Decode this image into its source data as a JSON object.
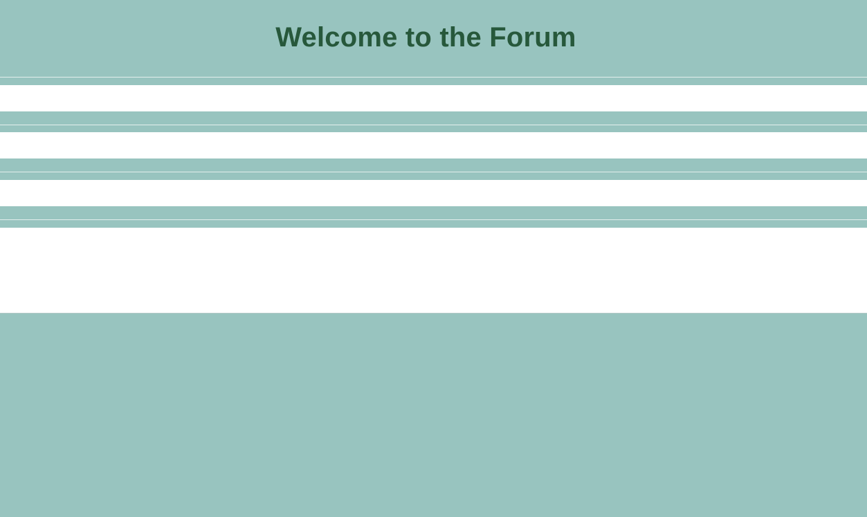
{
  "header": {
    "title": "Welcome to the Forum"
  },
  "colors": {
    "background": "#98c4bf",
    "title_text": "#27583b",
    "panel": "#ffffff",
    "separator": "#e3efed"
  },
  "posts": [
    {
      "content": ""
    },
    {
      "content": ""
    },
    {
      "content": ""
    },
    {
      "content": ""
    }
  ]
}
